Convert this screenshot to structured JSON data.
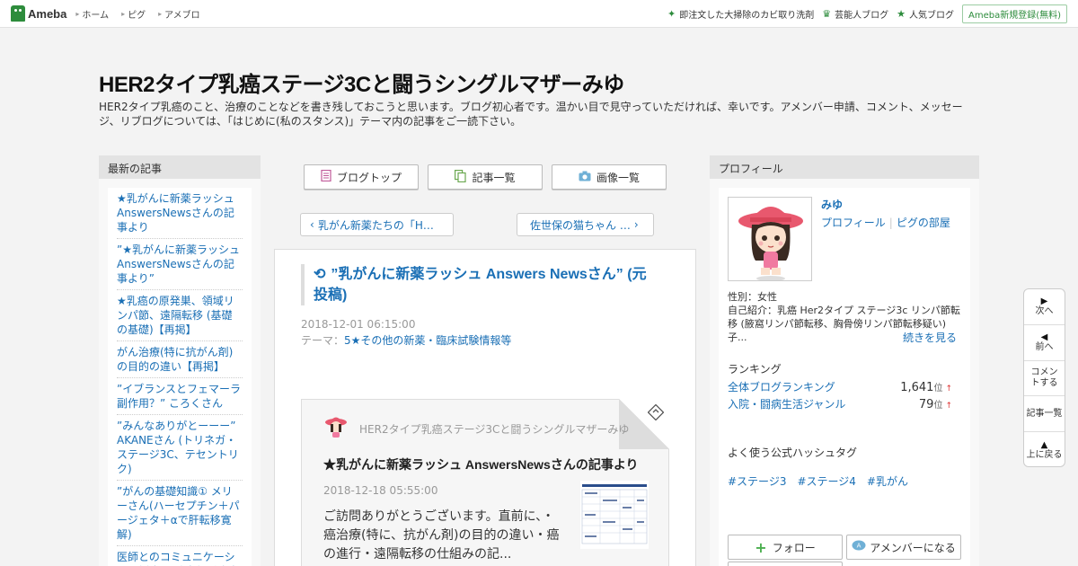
{
  "topbar": {
    "logo": "Ameba",
    "nav": [
      "ホーム",
      "ピグ",
      "アメブロ"
    ],
    "right_links": [
      {
        "icon": "sparkle-icon",
        "label": "即注文した大掃除のカビ取り洗剤"
      },
      {
        "icon": "crown-icon",
        "label": "芸能人ブログ"
      },
      {
        "icon": "star-icon",
        "label": "人気ブログ"
      }
    ],
    "register": "Ameba新規登録(無料)"
  },
  "header": {
    "title": "HER2タイプ乳癌ステージ3Cと闘うシングルマザーみゆ",
    "description": "HER2タイプ乳癌のこと、治療のことなどを書き残しておこうと思います。ブログ初心者です。温かい目で見守っていただければ、幸いです。アメンバー申請、コメント、メッセージ、リブログについては、「はじめに(私のスタンス)」テーマ内の記事をご一読下さい。"
  },
  "left": {
    "heading": "最新の記事",
    "articles": [
      "★乳がんに新薬ラッシュ AnswersNewsさんの記事より",
      "”★乳がんに新薬ラッシュ AnswersNewsさんの記事より”",
      "★乳癌の原発巣、領域リンパ節、遠隔転移 (基礎の基礎)【再掲】",
      "がん治療(特に抗がん剤)の目的の違い【再掲】",
      "”イブランスとフェマーラ副作用？” ころくさん",
      "”みんなありがとーーー” AKANEさん (トリネガ・ステージ3C、テセントリク)",
      "”がんの基礎知識① メリーさん(ハーセプチン＋パージェタ＋αで肝転移寛解)",
      "医師とのコミュニケーション例 押川勝太郎睡病内"
    ]
  },
  "center": {
    "tabs": [
      {
        "icon": "document-icon",
        "label": "ブログトップ"
      },
      {
        "icon": "copy-icon",
        "label": "記事一覧"
      },
      {
        "icon": "camera-icon",
        "label": "画像一覧"
      }
    ],
    "prev": "乳がん新薬たちの「H…",
    "next": "佐世保の猫ちゃん …",
    "article": {
      "title": "”乳がんに新薬ラッシュ Answers Newsさん” (元投稿)",
      "date": "2018-12-01 06:15:00",
      "theme_label": "テーマ：",
      "theme": "5★その他の新薬・臨床試験情報等",
      "card": {
        "blog_name": "HER2タイプ乳癌ステージ3Cと闘うシングルマザーみゆ",
        "title": "★乳がんに新薬ラッシュ AnswersNewsさんの記事より",
        "date": "2018-12-18 05:55:00",
        "excerpt": "ご訪問ありがとうございます。直前に、・癌治療(特に、抗がん剤)の目的の違い・癌の進行・遠隔転移の仕組みの記..."
      }
    }
  },
  "right": {
    "heading": "プロフィール",
    "name": "みゆ",
    "profile_link": "プロフィール",
    "pig_link": "ピグの部屋",
    "gender": "性別：女性",
    "intro": "自己紹介：乳癌 Her2タイプ ステージ3c リンパ節転移 (腋窩リンパ節転移、胸骨傍リンパ節転移疑い) 子...",
    "more": "続きを見る",
    "ranking_heading": "ランキング",
    "rankings": [
      {
        "name": "全体ブログランキング",
        "value": "1,641",
        "unit": "位",
        "arrow": "↑"
      },
      {
        "name": "入院・闘病生活ジャンル",
        "value": "79",
        "unit": "位",
        "arrow": "↑"
      }
    ],
    "hashtag_heading": "よく使う公式ハッシュタグ",
    "hashtags": [
      "#ステージ3",
      "#ステージ4",
      "#乳がん"
    ],
    "follow": "フォロー",
    "amember": "アメンバーになる"
  },
  "sidenav": [
    {
      "arrow": "▶",
      "label": "次へ"
    },
    {
      "arrow": "◀",
      "label": "前へ"
    },
    {
      "arrow": "",
      "label": "コメントする"
    },
    {
      "arrow": "",
      "label": "記事一覧"
    },
    {
      "arrow": "▲",
      "label": "上に戻る"
    }
  ]
}
